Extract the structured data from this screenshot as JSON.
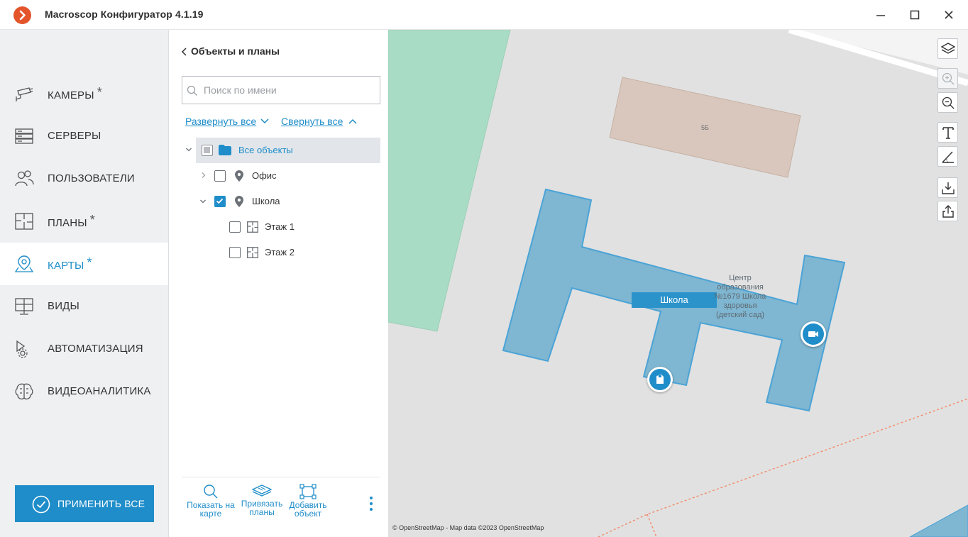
{
  "window": {
    "title": "Macroscop Конфигуратор 4.1.19",
    "accent": "#1f8dc9",
    "logo_color": "#e4542b"
  },
  "sidebar": {
    "items": [
      {
        "label": "КАМЕРЫ",
        "icon": "camera-icon",
        "modified": true,
        "active": false
      },
      {
        "label": "СЕРВЕРЫ",
        "icon": "server-icon",
        "modified": false,
        "active": false
      },
      {
        "label": "ПОЛЬЗОВАТЕЛИ",
        "icon": "users-icon",
        "modified": false,
        "active": false
      },
      {
        "label": "ПЛАНЫ",
        "icon": "floorplan-icon",
        "modified": true,
        "active": false
      },
      {
        "label": "КАРТЫ",
        "icon": "map-pin-icon",
        "modified": true,
        "active": true
      },
      {
        "label": "ВИДЫ",
        "icon": "monitor-grid-icon",
        "modified": false,
        "active": false
      },
      {
        "label": "АВТОМАТИЗАЦИЯ",
        "icon": "automation-gear-icon",
        "modified": false,
        "active": false
      },
      {
        "label": "ВИДЕОАНАЛИТИКА",
        "icon": "brain-icon",
        "modified": false,
        "active": false
      }
    ],
    "modified_mark": "*",
    "apply_label": "ПРИМЕНИТЬ ВСЕ"
  },
  "objects_panel": {
    "title": "Объекты и планы",
    "search_placeholder": "Поиск по имени",
    "expand_all": "Развернуть все",
    "collapse_all": "Свернуть все",
    "tree": {
      "root": {
        "label": "Все объекты",
        "state": "partial",
        "expanded": true
      },
      "office": {
        "label": "Офис",
        "state": "unchecked",
        "expanded": false
      },
      "school": {
        "label": "Школа",
        "state": "checked",
        "expanded": true
      },
      "floor1": {
        "label": "Этаж 1",
        "state": "unchecked"
      },
      "floor2": {
        "label": "Этаж 2",
        "state": "unchecked"
      }
    },
    "tools": {
      "show_on_map": "Показать на карте",
      "attach_plans": "Привязать планы",
      "add_object": "Добавить объект"
    }
  },
  "map": {
    "object_label": "Школа",
    "building_label": "Центр образования №1679 Школа здоровья (детский сад)",
    "house_number": "5Б",
    "attribution": "© OpenStreetMap - Map data ©2023 OpenStreetMap",
    "colors": {
      "background": "#e1e1e1",
      "park": "#a8dcc4",
      "building": "#d9c7bd",
      "object_fill": "#7fb6d1",
      "object_stroke": "#4ba3d6",
      "road": "#ffffff",
      "path": "#f28a6a"
    }
  }
}
